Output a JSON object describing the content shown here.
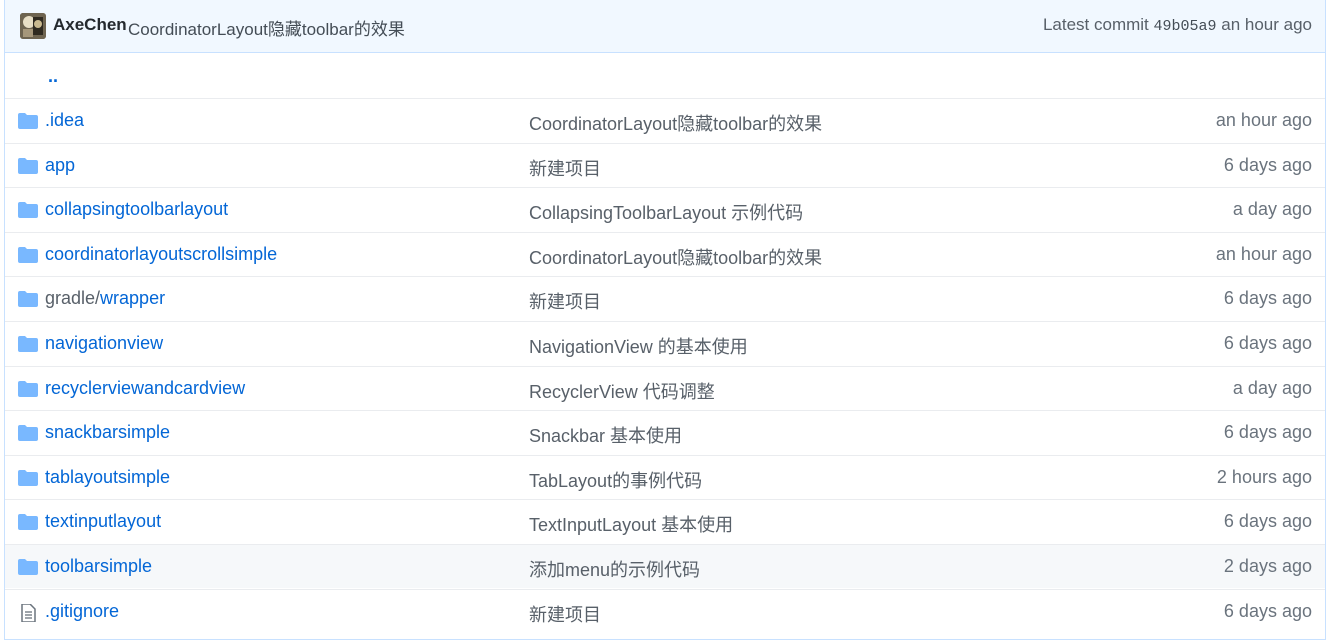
{
  "commit_bar": {
    "author": "AxeChen",
    "message": "CoordinatorLayout隐藏toolbar的效果",
    "latest_label": "Latest commit",
    "sha": "49b05a9",
    "time": "an hour ago"
  },
  "parent_link": "..",
  "rows": [
    {
      "type": "folder",
      "name": ".idea",
      "message": "CoordinatorLayout隐藏toolbar的效果",
      "age": "an hour ago"
    },
    {
      "type": "folder",
      "name": "app",
      "message": "新建项目",
      "age": "6 days ago"
    },
    {
      "type": "folder",
      "name": "collapsingtoolbarlayout",
      "message": "CollapsingToolbarLayout 示例代码",
      "age": "a day ago"
    },
    {
      "type": "folder",
      "name": "coordinatorlayoutscrollsimple",
      "message": "CoordinatorLayout隐藏toolbar的效果",
      "age": "an hour ago"
    },
    {
      "type": "folder",
      "name_prefix": "gradle/",
      "name": "wrapper",
      "message": "新建项目",
      "age": "6 days ago"
    },
    {
      "type": "folder",
      "name": "navigationview",
      "message": "NavigationView 的基本使用",
      "age": "6 days ago"
    },
    {
      "type": "folder",
      "name": "recyclerviewandcardview",
      "message": "RecyclerView 代码调整",
      "age": "a day ago"
    },
    {
      "type": "folder",
      "name": "snackbarsimple",
      "message": "Snackbar 基本使用",
      "age": "6 days ago"
    },
    {
      "type": "folder",
      "name": "tablayoutsimple",
      "message": "TabLayout的事例代码",
      "age": "2 hours ago"
    },
    {
      "type": "folder",
      "name": "textinputlayout",
      "message": "TextInputLayout 基本使用",
      "age": "6 days ago"
    },
    {
      "type": "folder",
      "name": "toolbarsimple",
      "message": "添加menu的示例代码",
      "age": "2 days ago",
      "hovered": true
    },
    {
      "type": "file",
      "name": ".gitignore",
      "message": "新建项目",
      "age": "6 days ago"
    }
  ],
  "colors": {
    "link": "#0366d6",
    "folder_icon": "#79b8ff",
    "commit_bar_bg": "#f1f8ff"
  }
}
